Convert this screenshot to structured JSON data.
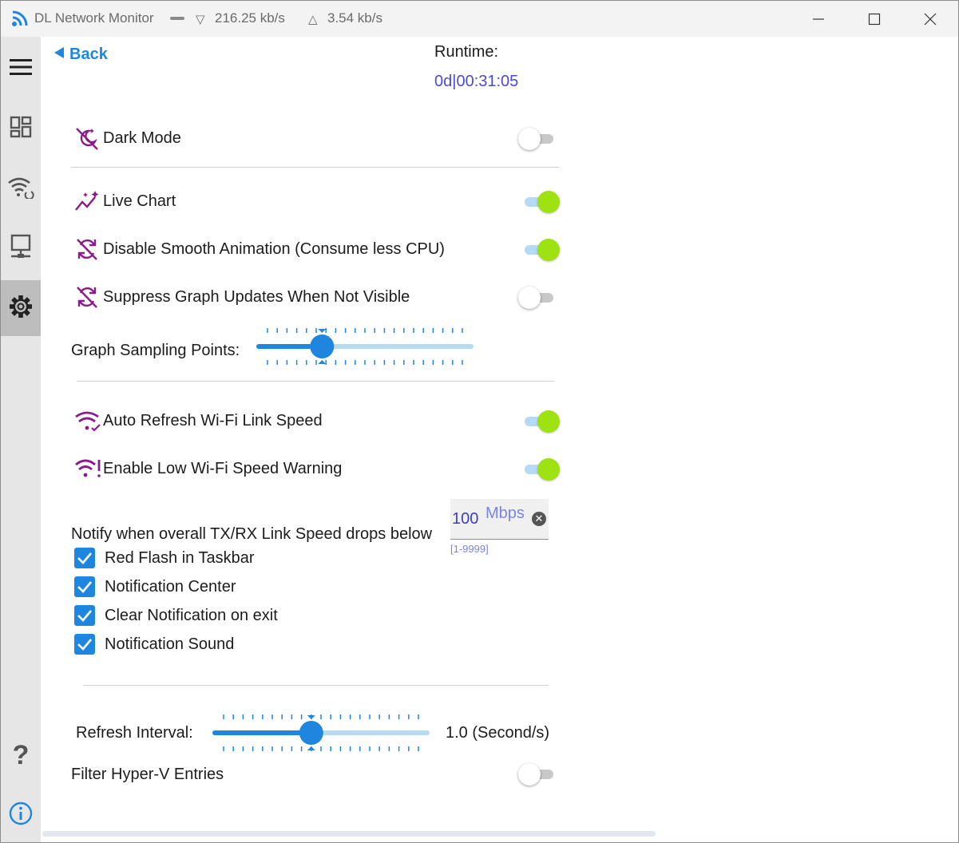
{
  "titlebar": {
    "app_name": "DL Network Monitor",
    "download_speed": "216.25 kb/s",
    "upload_speed": "3.54 kb/s",
    "download_arrow": "▽",
    "upload_arrow": "△"
  },
  "sidebar": {
    "items": [
      {
        "icon": "hamburger-menu-icon"
      },
      {
        "icon": "dashboard-icon"
      },
      {
        "icon": "wifi-refresh-icon"
      },
      {
        "icon": "monitor-network-icon"
      },
      {
        "icon": "gear-icon",
        "active": true
      },
      {
        "icon": "question-icon"
      },
      {
        "icon": "info-icon"
      }
    ]
  },
  "header": {
    "back_label": "Back",
    "runtime_label": "Runtime:",
    "runtime_value": "0d|00:31:05"
  },
  "settings": {
    "dark_mode": {
      "label": "Dark Mode",
      "on": false
    },
    "live_chart": {
      "label": "Live Chart",
      "on": true
    },
    "disable_smooth_animation": {
      "label": "Disable Smooth Animation (Consume less CPU)",
      "on": true
    },
    "suppress_graph_updates": {
      "label": "Suppress Graph Updates When Not Visible",
      "on": false
    },
    "graph_sampling_points": {
      "label": "Graph Sampling Points:",
      "level_fraction": 0.28
    },
    "auto_refresh_wifi": {
      "label": "Auto Refresh Wi-Fi Link Speed",
      "on": true
    },
    "low_wifi_warning": {
      "label": "Enable Low Wi-Fi Speed Warning",
      "on": true
    },
    "notify_label": "Notify when overall TX/RX Link Speed drops below",
    "speed_value": "100",
    "speed_unit": "Mbps",
    "speed_range_hint": "[1-9999]",
    "checkboxes": [
      {
        "label": "Red Flash in Taskbar",
        "checked": true
      },
      {
        "label": "Notification Center",
        "checked": true
      },
      {
        "label": "Clear Notification on exit",
        "checked": true
      },
      {
        "label": "Notification Sound",
        "checked": true
      }
    ],
    "refresh_interval": {
      "label": "Refresh Interval:",
      "value_text": "1.0 (Second/s)",
      "level_fraction": 0.45
    },
    "filter_hyperv": {
      "label": "Filter Hyper-V Entries",
      "on": false
    }
  },
  "colors": {
    "accent_blue": "#1f86e0",
    "toggle_on": "#9ee211",
    "icon_purple": "#8b1a8b",
    "runtime_text": "#4a4ad9"
  }
}
